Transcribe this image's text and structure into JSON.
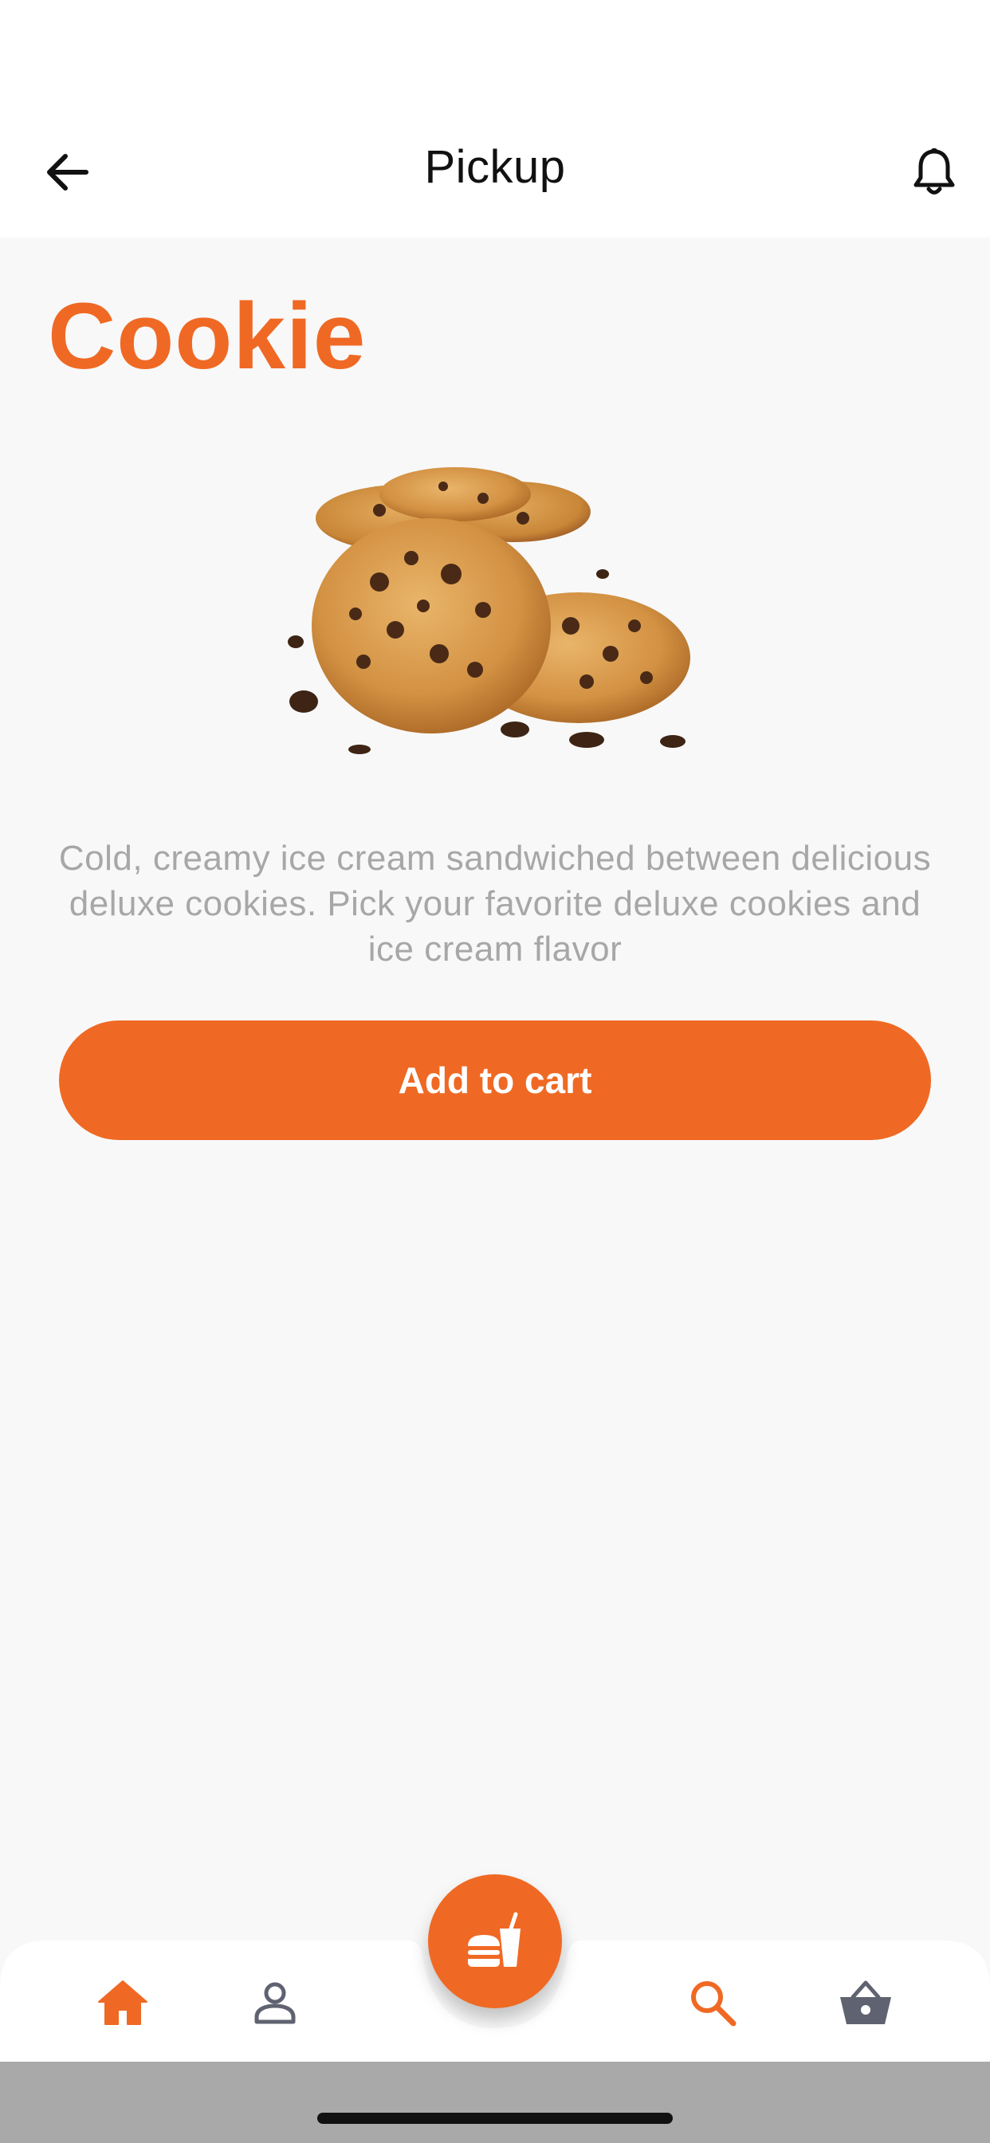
{
  "header": {
    "title": "Pickup",
    "back_icon": "arrow-left-icon",
    "notification_icon": "bell-icon"
  },
  "product": {
    "title": "Cookie",
    "image_alt": "cookies",
    "description": "Cold, creamy ice cream sandwiched between delicious deluxe cookies. Pick your favorite deluxe cookies and ice cream flavor",
    "add_to_cart_label": "Add to cart"
  },
  "bottom_nav": {
    "items": [
      {
        "name": "home",
        "icon": "home-icon",
        "active": true
      },
      {
        "name": "profile",
        "icon": "person-icon",
        "active": false
      },
      {
        "name": "search",
        "icon": "search-icon",
        "active": true
      },
      {
        "name": "basket",
        "icon": "basket-icon",
        "active": false
      }
    ],
    "fab_icon": "burger-drink-icon"
  },
  "colors": {
    "accent": "#ef6924",
    "inactive_icon": "#5f6270",
    "description_text": "#a7a7a7",
    "background": "#f8f8f8"
  }
}
